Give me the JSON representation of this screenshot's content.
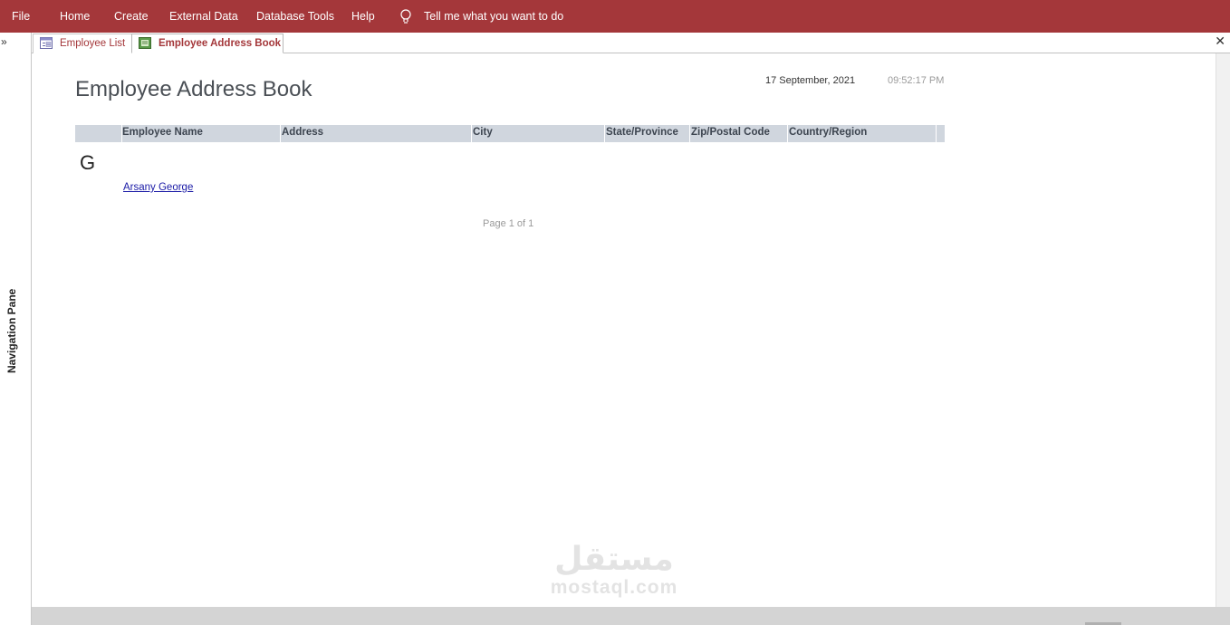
{
  "menu": {
    "items": [
      "File",
      "Home",
      "Create",
      "External Data",
      "Database Tools",
      "Help"
    ],
    "tell_me": "Tell me what you want to do"
  },
  "nav_pane": {
    "label": "Navigation Pane",
    "expand_glyph": "»"
  },
  "tabs": [
    {
      "label": "Employee List",
      "icon": "form-icon",
      "active": false
    },
    {
      "label": "Employee Address Book",
      "icon": "report-icon",
      "active": true
    }
  ],
  "close_glyph": "✕",
  "report": {
    "title": "Employee Address Book",
    "date": "17 September, 2021",
    "time": "09:52:17 PM",
    "columns": [
      "Employee Name",
      "Address",
      "City",
      "State/Province",
      "Zip/Postal Code",
      "Country/Region"
    ],
    "group_letter": "G",
    "employee": "Arsany George",
    "page": "Page 1 of 1"
  },
  "watermark": {
    "arabic": "مستقل",
    "latin": "mostaql.com"
  },
  "colors": {
    "ribbon": "#a4373a",
    "header_band": "#d0d6de",
    "link": "#1a1aa6"
  }
}
